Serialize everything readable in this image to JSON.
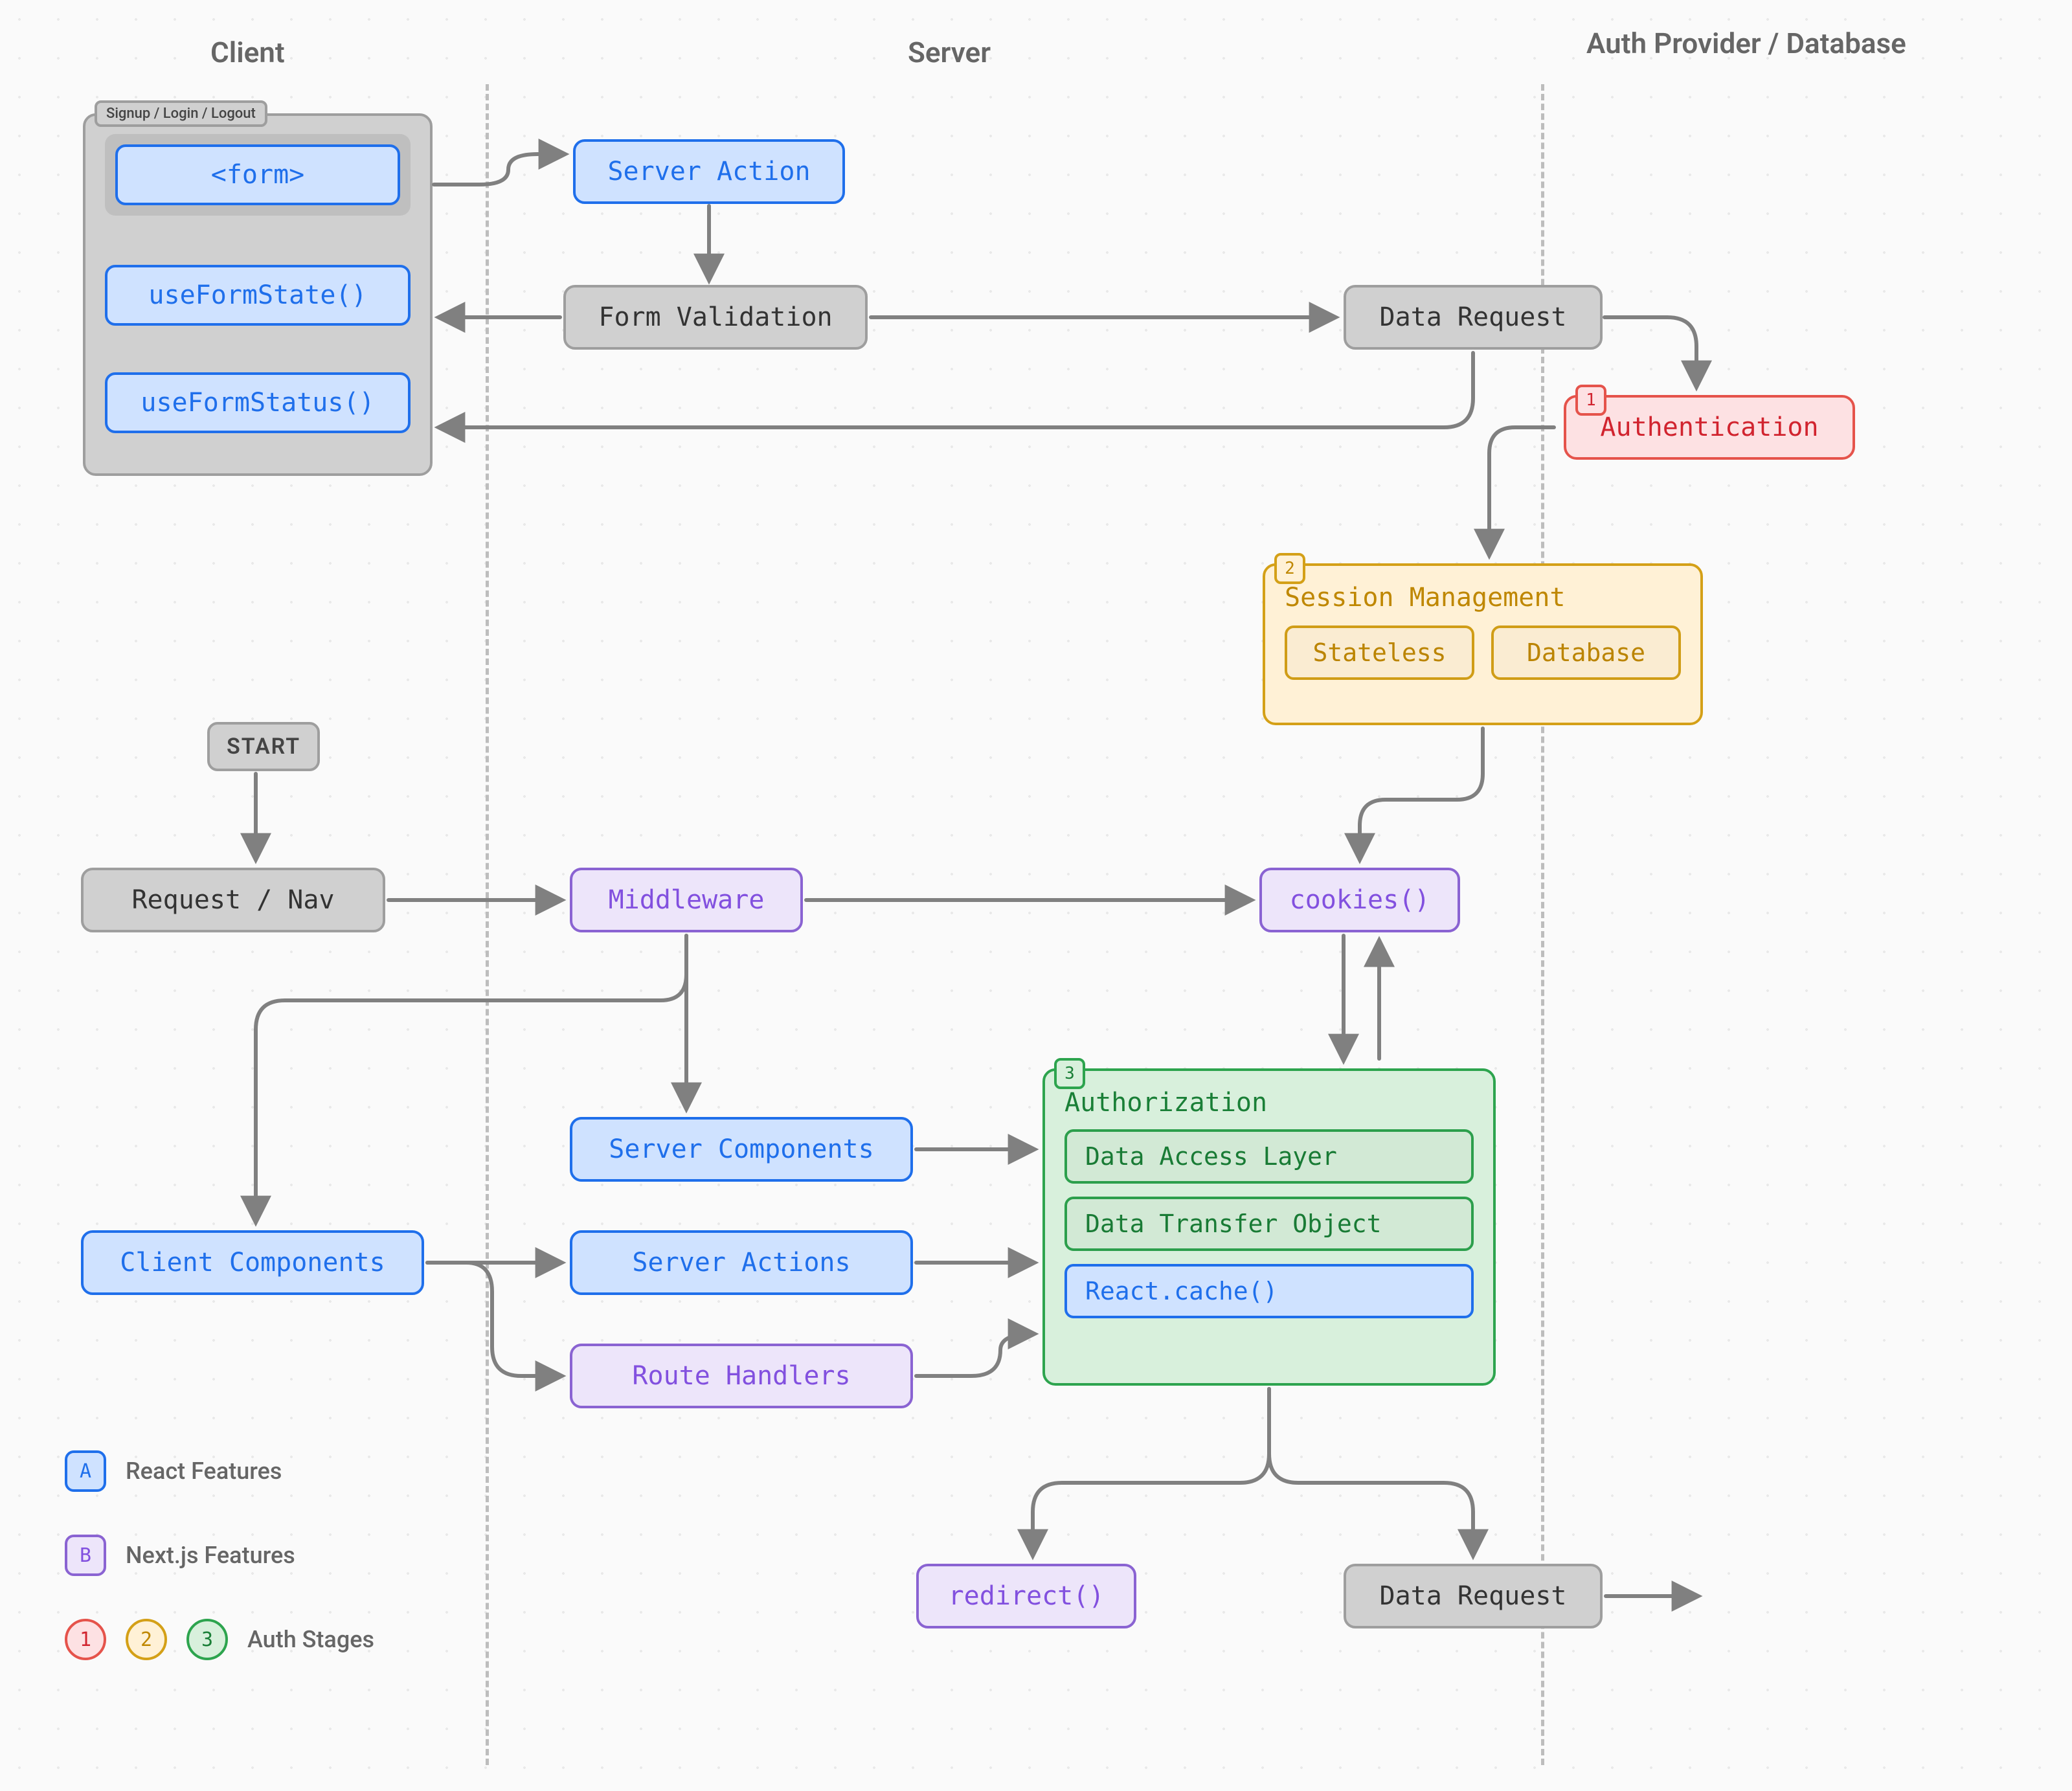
{
  "columns": {
    "client": "Client",
    "server": "Server",
    "auth": "Auth Provider / Database"
  },
  "client_panel": {
    "tag": "Signup / Login / Logout",
    "form": "<form>",
    "useFormState": "useFormState()",
    "useFormStatus": "useFormStatus()"
  },
  "server_action": "Server Action",
  "form_validation": "Form Validation",
  "data_request_top": "Data Request",
  "authentication": {
    "num": "1",
    "label": "Authentication"
  },
  "session": {
    "num": "2",
    "title": "Session Management",
    "stateless": "Stateless",
    "database": "Database"
  },
  "start": "START",
  "request_nav": "Request / Nav",
  "middleware": "Middleware",
  "cookies": "cookies()",
  "server_components": "Server Components",
  "server_actions": "Server Actions",
  "client_components": "Client Components",
  "route_handlers": "Route Handlers",
  "authorization": {
    "num": "3",
    "title": "Authorization",
    "dal": "Data Access Layer",
    "dto": "Data Transfer Object",
    "cache": "React.cache()"
  },
  "redirect": "redirect()",
  "data_request_bottom": "Data Request",
  "legend": {
    "react": "React Features",
    "next": "Next.js Features",
    "stages": "Auth Stages",
    "a": "A",
    "b": "B",
    "one": "1",
    "two": "2",
    "three": "3"
  }
}
